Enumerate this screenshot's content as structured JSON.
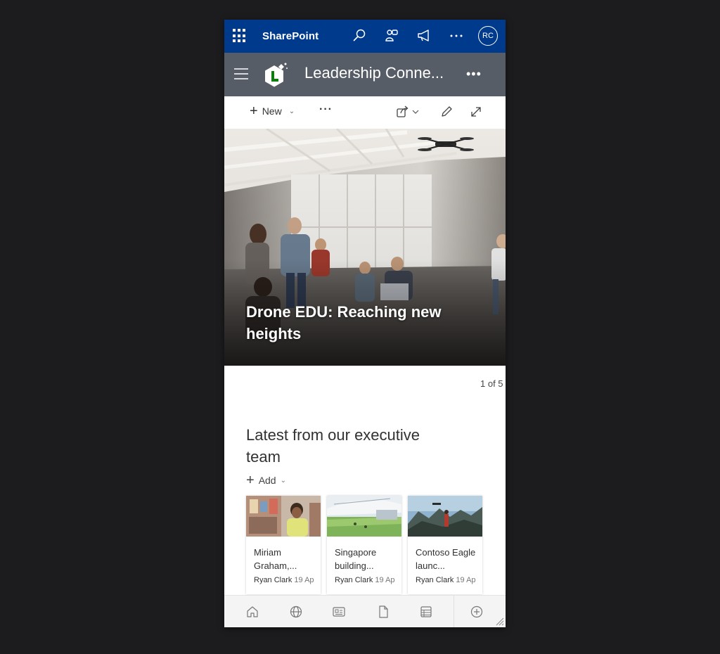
{
  "suite_bar": {
    "app_name": "SharePoint",
    "avatar_initials": "RC"
  },
  "site_header": {
    "title": "Leadership Conne..."
  },
  "command_bar": {
    "new_label": "New"
  },
  "hero": {
    "title": "Drone EDU: Reaching new heights",
    "pager": "1 of 5"
  },
  "news": {
    "section_title": "Latest from our executive team",
    "add_label": "Add",
    "cards": [
      {
        "title": "Miriam Graham,...",
        "author": "Ryan Clark",
        "date": "19 Ap"
      },
      {
        "title": "Singapore building...",
        "author": "Ryan Clark",
        "date": "19 Ap"
      },
      {
        "title": "Contoso Eagle launc...",
        "author": "Ryan Clark",
        "date": "19 Ap"
      }
    ]
  },
  "colors": {
    "suite_bar": "#003a8c",
    "site_header": "#575d66",
    "logo_accent": "#107c10"
  },
  "icons": {
    "suite_bar": [
      "app-launcher-icon",
      "search-icon",
      "people-icon",
      "megaphone-icon",
      "more-icon"
    ],
    "command_bar": [
      "plus-icon",
      "share-icon",
      "edit-icon",
      "expand-icon"
    ],
    "bottom_nav": [
      "home-icon",
      "globe-icon",
      "news-icon",
      "document-icon",
      "list-icon",
      "add-circle-icon"
    ]
  }
}
